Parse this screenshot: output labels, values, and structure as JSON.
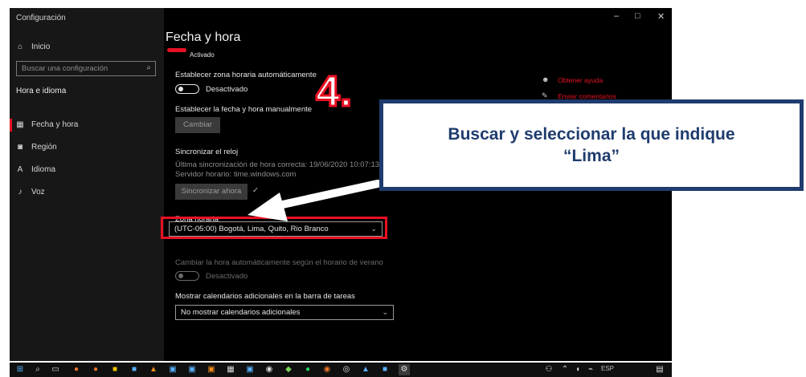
{
  "window": {
    "title": "Configuración",
    "minimize": "–",
    "maximize": "□",
    "close": "✕"
  },
  "sidebar": {
    "home": "Inicio",
    "search_placeholder": "Buscar una configuración",
    "section": "Hora e idioma",
    "items": [
      {
        "label": "Fecha y hora",
        "icon": "calendar-clock-icon",
        "active": true
      },
      {
        "label": "Región",
        "icon": "globe-icon",
        "active": false
      },
      {
        "label": "Idioma",
        "icon": "language-icon",
        "active": false
      },
      {
        "label": "Voz",
        "icon": "microphone-icon",
        "active": false
      }
    ]
  },
  "main": {
    "title": "Fecha y hora",
    "partial_top": "Activado",
    "auto_time_label": "Establecer zona horaria automáticamente",
    "auto_time_state": "Desactivado",
    "manual_label": "Establecer la fecha y hora manualmente",
    "change_button": "Cambiar",
    "sync_heading": "Sincronizar el reloj",
    "sync_last": "Última sincronización de hora correcta: 19/06/2020 10:07:13",
    "sync_server": "Servidor horario: time.windows.com",
    "sync_button": "Sincronizar ahora",
    "timezone_label": "Zona horaria",
    "timezone_value": "(UTC-05:00) Bogotá, Lima, Quito, Rio Branco",
    "dst_label": "Cambiar la hora automáticamente según el horario de verano",
    "dst_state": "Desactivado",
    "calendars_label": "Mostrar calendarios adicionales en la barra de tareas",
    "calendars_value": "No mostrar calendarios adicionales"
  },
  "help_links": {
    "get_help": "Obtener ayuda",
    "feedback": "Enviar comentarios"
  },
  "annotation": {
    "step": "4.",
    "callout_line1": "Buscar y seleccionar la que indique",
    "callout_line2": "“Lima”"
  },
  "taskbar": {
    "lang": "ESP"
  },
  "colors": {
    "accent": "#e81123",
    "callout": "#1f3c6e"
  }
}
